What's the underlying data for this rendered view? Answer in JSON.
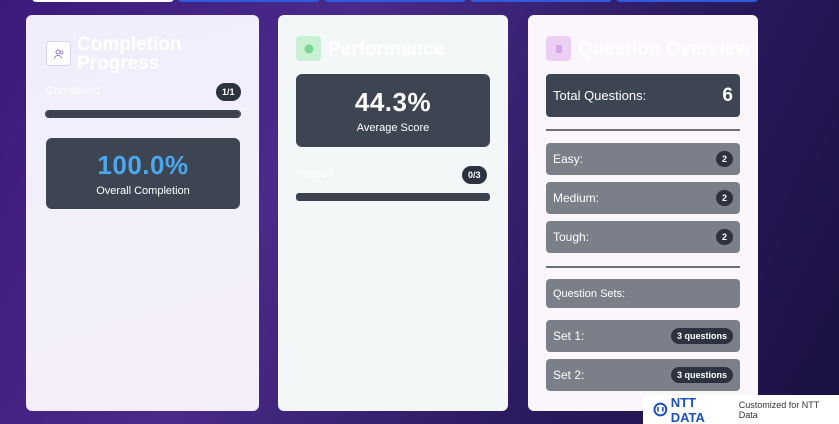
{
  "completion": {
    "title": "Completion Progress",
    "completed_label": "Completed",
    "completed_count": "1/1",
    "progress_fraction": 1.0,
    "overall_value": "100.0%",
    "overall_caption": "Overall Completion"
  },
  "score": {
    "title": "Performance",
    "average_value": "44.3%",
    "average_caption": "Average Score",
    "passed_label": "Passed",
    "passed_count": "0/3",
    "progress_fraction": 1.0
  },
  "questions": {
    "title": "Question Overview",
    "total_label": "Total Questions:",
    "total_value": "6",
    "difficulty": [
      {
        "label": "Easy:",
        "count": "2"
      },
      {
        "label": "Medium:",
        "count": "2"
      },
      {
        "label": "Tough:",
        "count": "2"
      }
    ],
    "sets_label": "Question Sets:",
    "sets": [
      {
        "label": "Set 1:",
        "count": "3 questions"
      },
      {
        "label": "Set 2:",
        "count": "3 questions"
      }
    ]
  },
  "branding": {
    "logo_text": "NTT DATA",
    "tagline": "Customized for NTT Data"
  },
  "colors": {
    "accent_blue": "#4aa8f0",
    "dark_panel": "#3d4452",
    "tab_blue": "#2f5be0"
  }
}
